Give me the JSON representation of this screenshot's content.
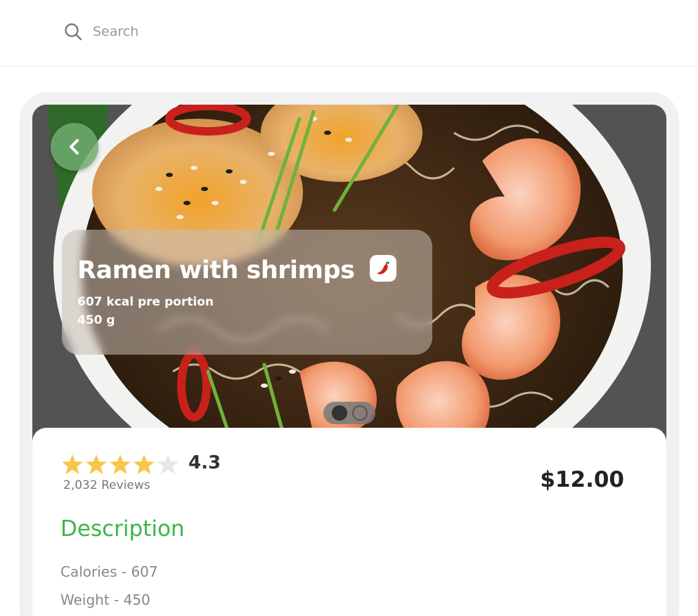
{
  "search": {
    "placeholder": "Search",
    "value": ""
  },
  "dish": {
    "title": "Ramen with shrimps",
    "kcal": "607 kcal pre portion",
    "weight": "450 g",
    "spicy_icon": "chili-pepper-icon"
  },
  "carousel": {
    "total": 2,
    "active_index": 0
  },
  "rating": {
    "value": "4.3",
    "stars_filled": 4,
    "stars_total": 5,
    "reviews": "2,032 Reviews",
    "star_color": "#f8c74a",
    "star_empty_color": "#e6e6e6"
  },
  "price": "$12.00",
  "description": {
    "heading": "Description",
    "calories": "Calories - 607",
    "weight": "Weight - 450"
  },
  "colors": {
    "accent": "#3db54a",
    "back_button": "#6eaa6e"
  }
}
